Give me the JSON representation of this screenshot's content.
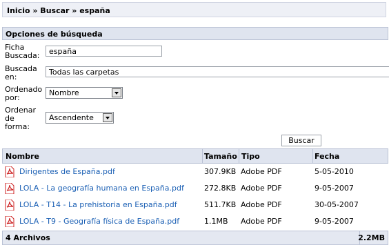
{
  "breadcrumb": "Inicio » Buscar » españa",
  "panel_title": "Opciones de búsqueda",
  "form": {
    "ficha_label": "Ficha Buscada:",
    "ficha_value": "españa",
    "buscada_label": "Buscada en:",
    "buscada_value": "Todas las carpetas",
    "ordenado_label": "Ordenado por:",
    "ordenado_value": "Nombre",
    "forma_label": "Ordenar de forma:",
    "forma_value": "Ascendente",
    "buscar_button": "Buscar"
  },
  "table": {
    "headers": [
      "Nombre",
      "Tamaño",
      "Tipo",
      "Fecha"
    ],
    "rows": [
      {
        "name": "Dirigentes de España.pdf",
        "size": "307.9KB",
        "type": "Adobe PDF",
        "date": "5-05-2010"
      },
      {
        "name": "LOLA - La geografía humana en España.pdf",
        "size": "272.8KB",
        "type": "Adobe PDF",
        "date": "9-05-2007"
      },
      {
        "name": "LOLA - T14 - La prehistoria en España.pdf",
        "size": "511.7KB",
        "type": "Adobe PDF",
        "date": "30-05-2007"
      },
      {
        "name": "LOLA - T9 - Geografía física de España.pdf",
        "size": "1.1MB",
        "type": "Adobe PDF",
        "date": "9-05-2007"
      }
    ],
    "footer_count": "4 Archivos",
    "footer_total": "2.2MB"
  },
  "icons": {
    "file": "pdf-file-icon",
    "dropdown": "chevron-down-icon"
  },
  "colors": {
    "link": "#1a5fb4",
    "header_bg": "#dfe4ef",
    "pdf_red": "#cc1f1f"
  }
}
